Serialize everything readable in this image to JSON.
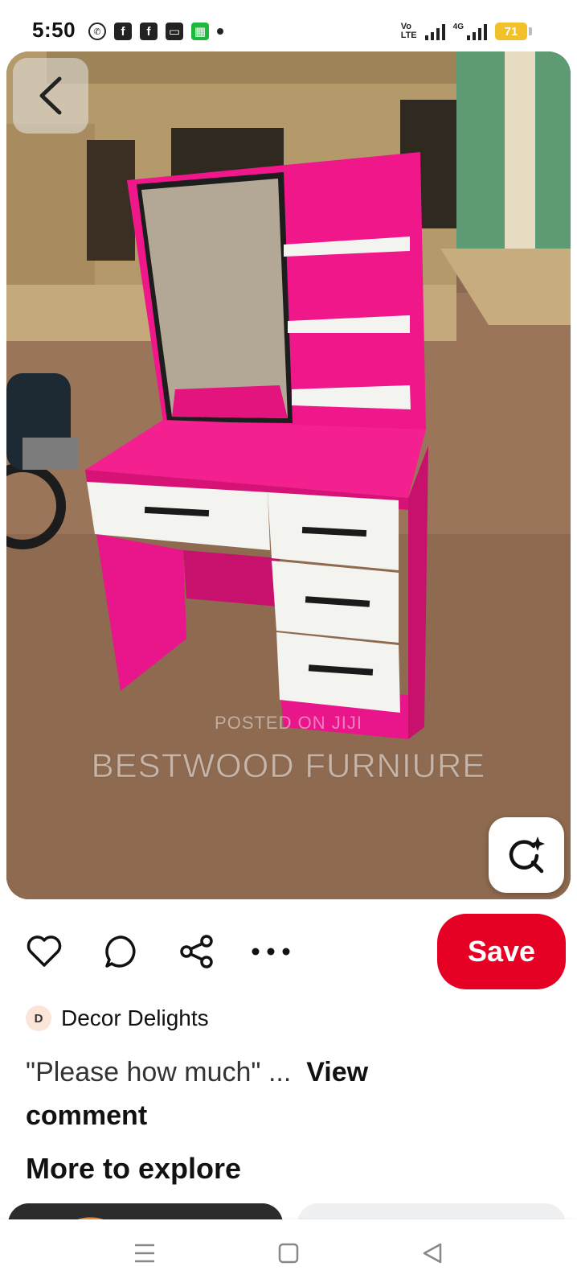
{
  "status_bar": {
    "time": "5:50",
    "left_icons": [
      "whatsapp-icon",
      "facebook-icon",
      "facebook-icon",
      "bus-icon",
      "app-icon"
    ],
    "network_label": "4G",
    "volte_label_1": "Vo",
    "volte_label_2": "LTE",
    "battery": "71",
    "battery_color": "#f2c029"
  },
  "hero": {
    "alt": "Pink and white dressing table with mirror and shelves",
    "watermark_small": "POSTED ON JIJI",
    "watermark_large": "BESTWOOD FURNIURE"
  },
  "actions": {
    "like_icon": "heart-icon",
    "comment_icon": "comment-icon",
    "share_icon": "share-icon",
    "more_icon": "more-icon",
    "save_label": "Save",
    "accent": "#e60023"
  },
  "creator": {
    "initial": "D",
    "name": "Decor Delights"
  },
  "comment": {
    "text": "\"Please how much\" ...",
    "link": "View comment"
  },
  "more_to_explore": {
    "title": "More to explore"
  },
  "nav": {
    "items": [
      "menu-icon",
      "home-square-icon",
      "back-triangle-icon"
    ]
  }
}
